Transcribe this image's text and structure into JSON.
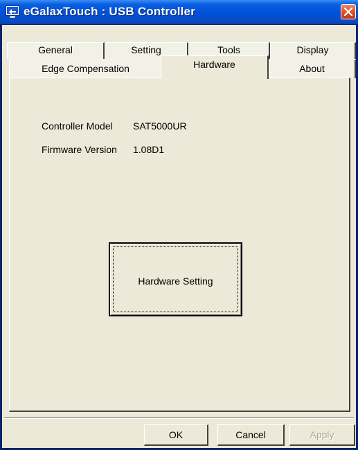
{
  "window": {
    "title": "eGalaxTouch : USB Controller"
  },
  "tabs": {
    "row_top": [
      {
        "label": "General"
      },
      {
        "label": "Setting"
      },
      {
        "label": "Tools"
      },
      {
        "label": "Display"
      }
    ],
    "row_bottom": [
      {
        "label": "Edge Compensation"
      },
      {
        "label": "Hardware",
        "active": true
      },
      {
        "label": "About"
      }
    ]
  },
  "hardware": {
    "controller_model_label": "Controller Model",
    "controller_model_value": "SAT5000UR",
    "firmware_version_label": "Firmware Version",
    "firmware_version_value": "1.08D1",
    "hardware_setting_label": "Hardware Setting"
  },
  "footer": {
    "ok_label": "OK",
    "cancel_label": "Cancel",
    "apply_label": "Apply"
  },
  "icons": {
    "app": "egalax-app-icon",
    "close": "close-icon"
  },
  "colors": {
    "titlebar": "#0050d8",
    "face": "#ece9d8",
    "close": "#e0502a"
  }
}
